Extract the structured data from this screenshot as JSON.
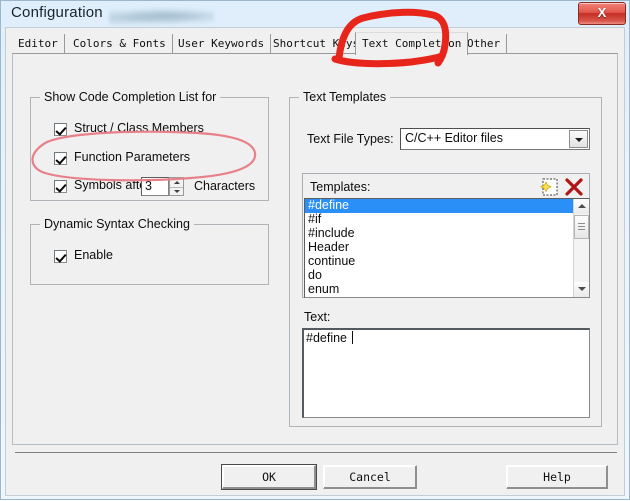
{
  "window": {
    "title": "Configuration",
    "close_label": "X"
  },
  "tabs": [
    {
      "label": "Editor",
      "selected": false
    },
    {
      "label": "Colors & Fonts",
      "selected": false
    },
    {
      "label": "User Keywords",
      "selected": false
    },
    {
      "label": "Shortcut Keys",
      "selected": false
    },
    {
      "label": "Text Completion",
      "selected": true
    },
    {
      "label": "Other",
      "selected": false
    }
  ],
  "left_panel": {
    "completion_group": {
      "title": "Show Code Completion List for",
      "checkboxes": [
        {
          "label": "Struct / Class Members",
          "checked": true
        },
        {
          "label": "Function Parameters",
          "checked": true
        },
        {
          "label": "Symbols after",
          "checked": true
        }
      ],
      "symbols_value": "3",
      "symbols_suffix": "Characters"
    },
    "syntax_group": {
      "title": "Dynamic Syntax Checking",
      "checkboxes": [
        {
          "label": "Enable",
          "checked": true
        }
      ]
    }
  },
  "right_panel": {
    "group_title": "Text Templates",
    "file_types_label": "Text File Types:",
    "file_types_value": "C/C++ Editor files",
    "templates_label": "Templates:",
    "new_icon_name": "new-template-icon",
    "delete_icon_name": "delete-template-icon",
    "templates": [
      "#define",
      "#if",
      "#include",
      "Header",
      "continue",
      "do",
      "enum"
    ],
    "selected_template": "#define",
    "text_label": "Text:",
    "text_value": "#define "
  },
  "buttons": {
    "ok": "OK",
    "cancel": "Cancel",
    "help": "Help"
  },
  "annotation_colors": {
    "tab_highlight": "#e8251a",
    "option_circle": "#e8808a"
  }
}
